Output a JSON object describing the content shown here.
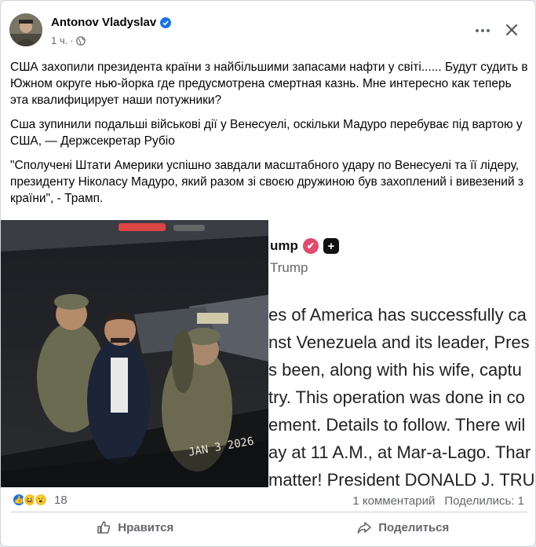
{
  "post": {
    "author": "Antonov Vladyslav",
    "time": "1 ч.",
    "separator": "·",
    "paragraphs": [
      "США захопили президента країни з найбільшими запасами нафти у світі...... Будут судить в Южном округе нью-йорка где предусмотрена смертная казнь.  Мне интересно как теперь эта квалифицирует наши потужники?",
      "Сша зупинили подальші військові дії у Венесуелі, оскільки Мадуро перебуває під вартою у США, — Держсекретар Рубіо",
      "\"Сполучені Штати Америки успішно завдали масштабного удару по Венесуелі та її лідеру, президенту Ніколасу Мадуро, який разом зі своєю дружиною був захоплений і вивезений з країни\", - Трамп."
    ]
  },
  "media": {
    "photo_stamp": "JAN 3 2026",
    "screenshot": {
      "name": "ump",
      "handle": "Trump",
      "lines": [
        "es of America has successfully ca",
        "nst Venezuela and its leader, Pres",
        "s been, along with his wife, captu",
        "try. This operation was done in co",
        "ement. Details to follow. There wil",
        "ay at 11 A.M., at Mar-a-Lago. Thar",
        "matter! President DONALD J. TRU"
      ]
    }
  },
  "footer": {
    "reaction_count": "18",
    "comments": "1 комментарий",
    "shares": "Поделились: 1",
    "like_label": "Нравится",
    "share_label": "Поделиться"
  },
  "colors": {
    "accent": "#1b74e4",
    "muted": "#65676b"
  },
  "icons": [
    "verified-icon",
    "globe-icon",
    "more-icon",
    "close-icon",
    "like-reaction-icon",
    "haha-reaction-icon",
    "wow-reaction-icon",
    "thumbs-up-icon",
    "share-arrow-icon"
  ]
}
